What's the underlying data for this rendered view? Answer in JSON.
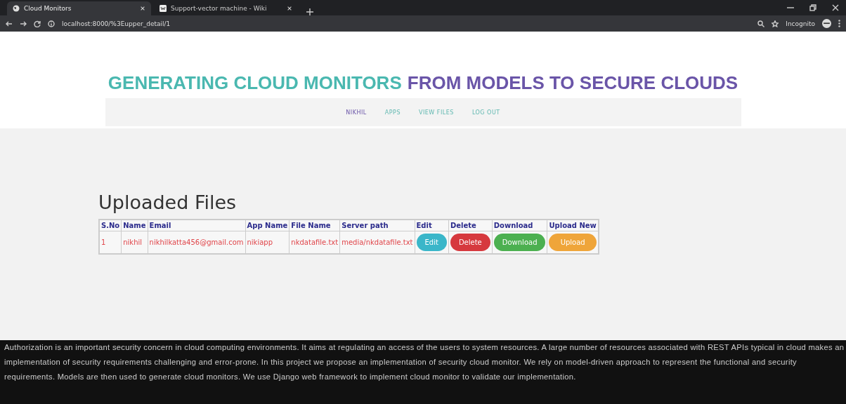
{
  "browser": {
    "tabs": [
      {
        "title": "Cloud Monitors",
        "selected": true
      },
      {
        "title": "Support-vector machine - Wiki",
        "selected": false
      }
    ],
    "address": "localhost:8000/%3Eupper_detail/1",
    "profile": "Incognito"
  },
  "header": {
    "title_parts": [
      {
        "text": "GENERATING CLOUD MONITORS",
        "color": "#4ab8b0"
      },
      {
        "text": "FROM MODELS TO SECURE CLOUDS",
        "color": "#6a55a8"
      }
    ],
    "nav": [
      {
        "label": "NIKHIL"
      },
      {
        "label": "APPS"
      },
      {
        "label": "VIEW FILES"
      },
      {
        "label": "LOG OUT"
      }
    ]
  },
  "heading": "Uploaded Files",
  "table": {
    "columns": [
      "S.No",
      "Name",
      "Email",
      "App Name",
      "File Name",
      "Server path",
      "Edit",
      "Delete",
      "Download",
      "Upload New"
    ],
    "rows": [
      {
        "cells": [
          "1",
          "nikhil",
          "nikhilkatta456@gmail.com",
          "nikiapp",
          "nkdatafile.txt",
          "media/nkdatafile.txt"
        ],
        "actions": [
          {
            "label": "Edit",
            "color": "#3ab6c9"
          },
          {
            "label": "Delete",
            "color": "#d6393e"
          },
          {
            "label": "Download",
            "color": "#4cb050"
          },
          {
            "label": "Upload",
            "color": "#efa53a"
          }
        ]
      }
    ]
  },
  "footer": "Authorization is an important security concern in cloud computing environments. It aims at regulating an access of the users to system resources. A large number of resources associated with REST APIs typical in cloud makes an implementation of security requirements challenging and error-prone. In this project we propose an implementation of security cloud monitor. We rely on model-driven approach to represent the functional and security requirements. Models are then used to generate cloud monitors. We use Django web framework to implement cloud monitor to validate our implementation."
}
